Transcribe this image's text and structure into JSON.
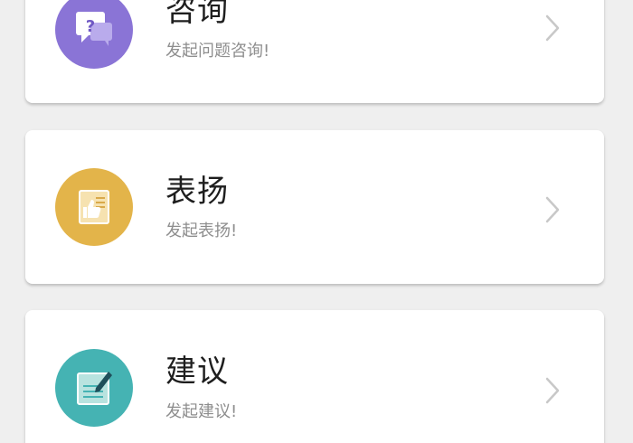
{
  "items": [
    {
      "title": "咨询",
      "subtitle": "发起问题咨询!",
      "icon": "consult-question-icon",
      "color": "#8a74d6"
    },
    {
      "title": "表扬",
      "subtitle": "发起表扬!",
      "icon": "praise-thumbs-up-icon",
      "color": "#e3b44a"
    },
    {
      "title": "建议",
      "subtitle": "发起建议!",
      "icon": "suggestion-edit-icon",
      "color": "#45b3b3"
    }
  ],
  "chevron_icon": "chevron-right-icon"
}
